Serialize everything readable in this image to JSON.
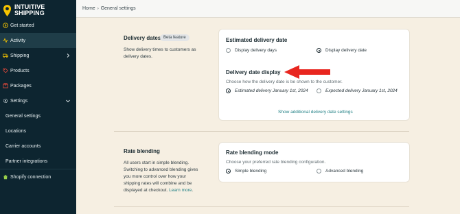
{
  "brand": {
    "line1": "INTUITIVE",
    "line2": "SHIPPING",
    "accent": "#f5c400"
  },
  "sidebar": {
    "items": [
      {
        "label": "Get started",
        "icon": "arrow-circle-icon"
      },
      {
        "label": "Activity",
        "icon": "activity-icon"
      },
      {
        "label": "Shipping",
        "icon": "truck-icon"
      },
      {
        "label": "Products",
        "icon": "tag-icon"
      },
      {
        "label": "Packages",
        "icon": "box-icon"
      },
      {
        "label": "Settings",
        "icon": "gear-icon"
      }
    ],
    "sub_items": [
      {
        "label": "General settings"
      },
      {
        "label": "Locations"
      },
      {
        "label": "Carrier accounts"
      },
      {
        "label": "Partner integrations"
      }
    ],
    "footer_item": {
      "label": "Shopify connection",
      "icon": "shopify-icon"
    }
  },
  "breadcrumb": {
    "home": "Home",
    "current": "General settings"
  },
  "delivery": {
    "title": "Delivery dates",
    "badge": "Beta feature",
    "description": "Show delivery times to customers as delivery dates.",
    "card": {
      "title": "Estimated delivery date",
      "option_days": "Display delivery days",
      "option_date": "Display delivery date",
      "selected": "Display delivery date",
      "display_title": "Delivery date display",
      "display_help": "Choose how the delivery date is be shown to the customer.",
      "option_estimated": "Estimated delivery January 1st, 2024",
      "option_expected": "Expected delivery January 1st, 2024",
      "display_selected": "Estimated delivery January 1st, 2024",
      "link": "Show additional delivery date settings"
    }
  },
  "blending": {
    "title": "Rate blending",
    "description": "All users start in simple blending. Switching to advanced blending gives you more control over how your shipping rates will combine and be displayed at checkout.",
    "learn_more": "Learn more",
    "learn_more_suffix": ".",
    "card": {
      "title": "Rate blending mode",
      "help": "Choose your preferred rate blending configuration.",
      "option_simple": "Simple blending",
      "option_advanced": "Advanced blending",
      "selected": "Simple blending"
    }
  },
  "annotation": {
    "arrow_color": "#e8261f"
  }
}
